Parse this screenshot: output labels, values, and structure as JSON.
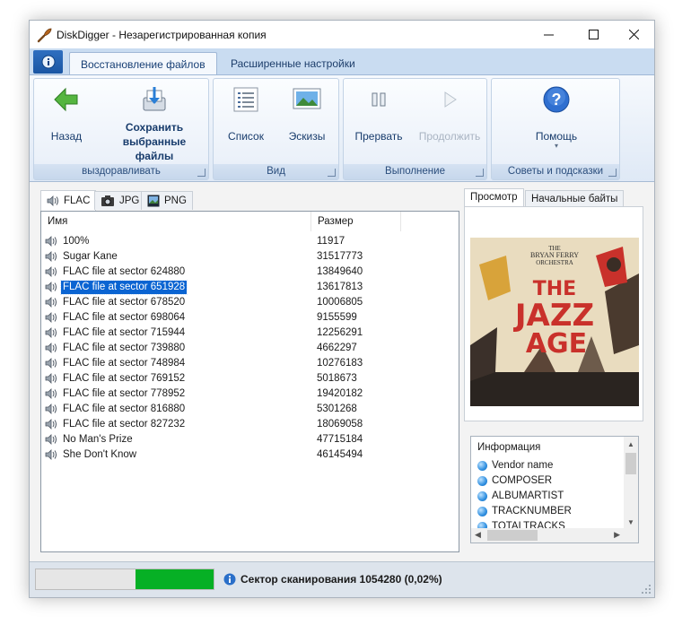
{
  "window": {
    "title": "DiskDigger - Незарегистрированная копия",
    "controls": [
      "minimize",
      "maximize",
      "close"
    ]
  },
  "ribbon": {
    "tabs": [
      "Восстановление файлов",
      "Расширенные настройки"
    ],
    "active_tab": "Восстановление файлов",
    "groups": {
      "recover": {
        "label": "выздоравливать",
        "back": "Назад",
        "save_line1": "Сохранить",
        "save_line2": "выбранные",
        "save_line3": "файлы"
      },
      "view": {
        "label": "Вид",
        "list": "Список",
        "thumbs": "Эскизы"
      },
      "execution": {
        "label": "Выполнение",
        "stop": "Прервать",
        "continue": "Продолжить"
      },
      "help": {
        "label": "Советы и подсказки",
        "help": "Помощь"
      }
    }
  },
  "file_tabs": [
    "FLAC",
    "JPG",
    "PNG"
  ],
  "active_file_tab": "FLAC",
  "columns": {
    "name": "Имя",
    "size": "Размер"
  },
  "files": [
    {
      "name": "100%",
      "size": "11917"
    },
    {
      "name": "Sugar Kane",
      "size": "31517773"
    },
    {
      "name": "FLAC file at sector 624880",
      "size": "13849640"
    },
    {
      "name": "FLAC file at sector 651928",
      "size": "13617813",
      "selected": true
    },
    {
      "name": "FLAC file at sector 678520",
      "size": "10006805"
    },
    {
      "name": "FLAC file at sector 698064",
      "size": "9155599"
    },
    {
      "name": "FLAC file at sector 715944",
      "size": "12256291"
    },
    {
      "name": "FLAC file at sector 739880",
      "size": "4662297"
    },
    {
      "name": "FLAC file at sector 748984",
      "size": "10276183"
    },
    {
      "name": "FLAC file at sector 769152",
      "size": "5018673"
    },
    {
      "name": "FLAC file at sector 778952",
      "size": "19420182"
    },
    {
      "name": "FLAC file at sector 816880",
      "size": "5301268"
    },
    {
      "name": "FLAC file at sector 827232",
      "size": "18069058"
    },
    {
      "name": "No Man's Prize",
      "size": "47715184"
    },
    {
      "name": "She Don't Know",
      "size": "46145494"
    }
  ],
  "preview_tabs": [
    "Просмотр",
    "Начальные байты"
  ],
  "album_art": {
    "line1": "THE",
    "line2": "BRYAN FERRY",
    "line3": "ORCHESTRA",
    "word1": "THE",
    "word2": "JAZZ",
    "word3": "AGE"
  },
  "info": {
    "title": "Информация",
    "items": [
      "Vendor name",
      "COMPOSER",
      "ALBUMARTIST",
      "TRACKNUMBER",
      "TOTALTRACKS"
    ]
  },
  "status": {
    "text": "Сектор сканирования 1054280 (0,02%)",
    "progress_start": 0.56,
    "progress_end": 1.0
  },
  "colors": {
    "accent": "#0a64d2",
    "progress": "#06b025",
    "album_bg": "#e9dcbf",
    "album_title": "#c9312b"
  }
}
